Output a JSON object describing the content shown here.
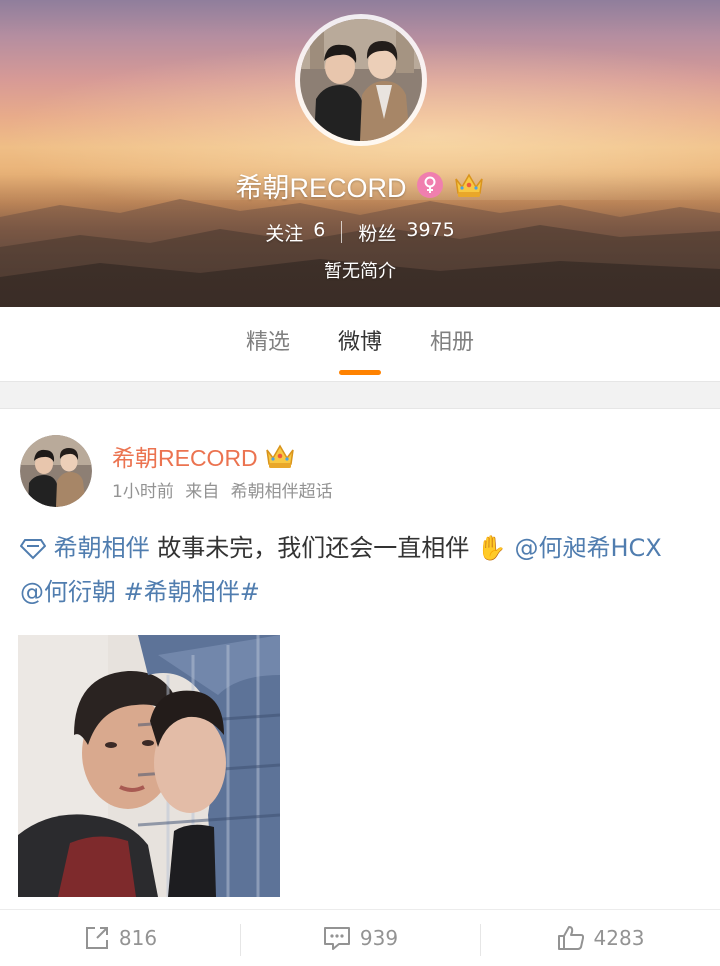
{
  "profile": {
    "name": "希朝RECORD",
    "following_label": "关注",
    "following_count": "6",
    "followers_label": "粉丝",
    "followers_count": "3975",
    "bio": "暂无简介",
    "gender_icon": "female-icon",
    "vip_icon": "crown-icon"
  },
  "tabs": [
    {
      "label": "精选",
      "active": false
    },
    {
      "label": "微博",
      "active": true
    },
    {
      "label": "相册",
      "active": false
    }
  ],
  "post": {
    "author": "希朝RECORD",
    "time": "1小时前",
    "source_prefix": "来自",
    "source": "希朝相伴超话",
    "supertopic_link": "希朝相伴",
    "text": "故事未完，我们还会一直相伴",
    "emoji": "✋",
    "mention_1": "@何昶希HCX",
    "mention_2": "@何衍朝",
    "hashtag": "#希朝相伴#",
    "reposts": "816",
    "comments": "939",
    "likes": "4283"
  },
  "colors": {
    "accent": "#ff8200",
    "author_name": "#eb7350",
    "link": "#507daf",
    "meta": "#939393"
  }
}
